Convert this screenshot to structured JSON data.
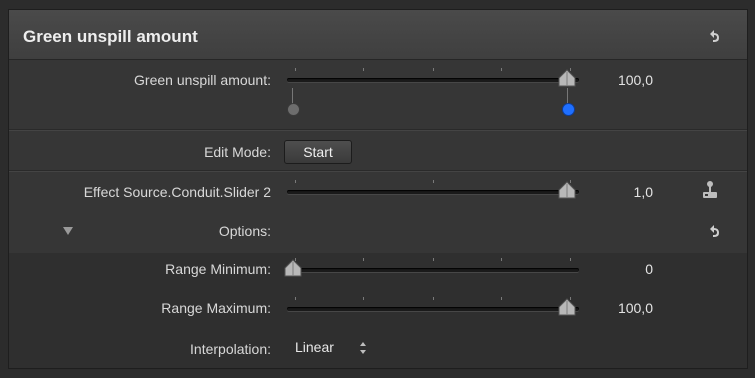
{
  "header": {
    "title": "Green unspill amount",
    "reset_icon": "reset-arrow-icon"
  },
  "rows": {
    "green_unspill": {
      "label": "Green unspill amount:",
      "value": "100,0",
      "fraction": 1.0
    },
    "edit_mode": {
      "label": "Edit Mode:",
      "button": "Start"
    },
    "effect_source": {
      "label": "Effect Source.Conduit.Slider 2",
      "value": "1,0",
      "fraction": 1.0,
      "icon": "joystick-icon"
    },
    "options": {
      "label": "Options:",
      "disclosure_icon": "triangle-down-icon",
      "reset_icon": "reset-arrow-icon"
    },
    "range_min": {
      "label": "Range Minimum:",
      "value": "0",
      "fraction": 0.0
    },
    "range_max": {
      "label": "Range Maximum:",
      "value": "100,0",
      "fraction": 1.0
    },
    "interpolation": {
      "label": "Interpolation:",
      "value": "Linear",
      "icon": "up-down-arrows-icon"
    }
  },
  "colors": {
    "keyframe_blue": "#1f6fff",
    "keyframe_grey": "#7a7a7a"
  }
}
